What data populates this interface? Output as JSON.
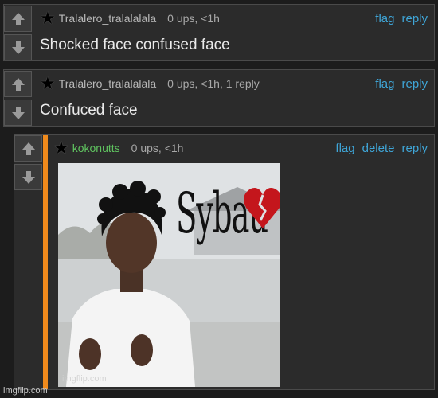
{
  "comments": [
    {
      "username": "Tralalero_tralalalala",
      "meta": "0 ups, <1h",
      "text": "Shocked face confused face",
      "actions": {
        "flag": "flag",
        "reply": "reply"
      }
    },
    {
      "username": "Tralalero_tralalalala",
      "meta": "0 ups, <1h, 1 reply",
      "text": "Confuced face",
      "actions": {
        "flag": "flag",
        "reply": "reply"
      }
    },
    {
      "username": "kokonutts",
      "meta": "0 ups, <1h",
      "image_caption": "Sybau",
      "image_watermark": "imgflip.com",
      "actions": {
        "flag": "flag",
        "delete": "delete",
        "reply": "reply"
      }
    }
  ],
  "footer_watermark": "imgflip.com",
  "icons": {
    "upvote": "up-arrow-icon",
    "downvote": "down-arrow-icon",
    "user_badge": "star-icon",
    "heart": "broken-heart-icon"
  },
  "colors": {
    "background": "#1c1c1c",
    "panel": "#2b2b2b",
    "link": "#3fa6d8",
    "reply_bar": "#f08a1c",
    "username_green": "#5fc25f"
  }
}
